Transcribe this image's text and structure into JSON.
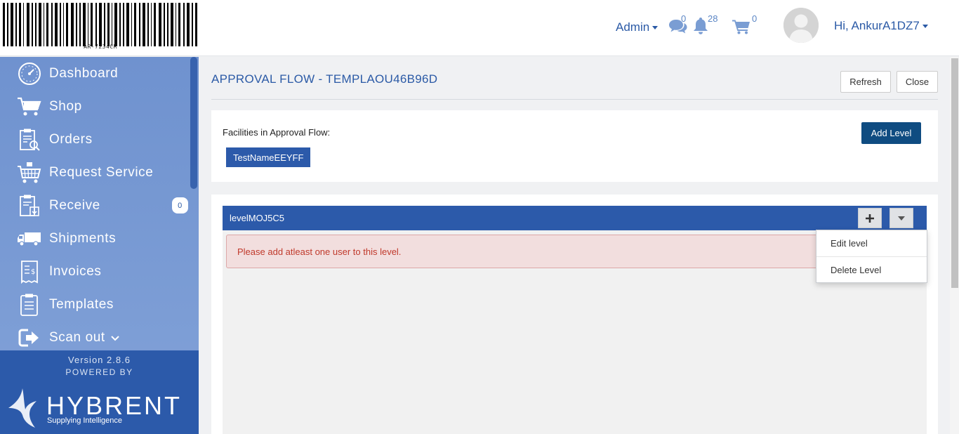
{
  "header": {
    "barcode_text": "AR-7234CR",
    "admin_label": "Admin",
    "messages_count": "0",
    "notifications_count": "28",
    "cart_count": "0",
    "user_greeting": "Hi, AnkurA1DZ7"
  },
  "sidebar": {
    "items": [
      {
        "label": "Dashboard",
        "icon": "dashboard-icon"
      },
      {
        "label": "Shop",
        "icon": "cart-icon"
      },
      {
        "label": "Orders",
        "icon": "orders-clipboard-icon"
      },
      {
        "label": "Request Service",
        "icon": "service-cart-icon"
      },
      {
        "label": "Receive",
        "icon": "receive-icon",
        "badge": "0"
      },
      {
        "label": "Shipments",
        "icon": "truck-icon"
      },
      {
        "label": "Invoices",
        "icon": "invoice-icon"
      },
      {
        "label": "Templates",
        "icon": "templates-icon"
      },
      {
        "label": "Scan out",
        "icon": "scan-out-icon"
      }
    ],
    "footer": {
      "version": "Version 2.8.6",
      "powered_by": "POWERED BY",
      "brand": "HYBRENT",
      "tagline": "Supplying Intelligence"
    }
  },
  "main": {
    "title": "APPROVAL FLOW - TEMPLAOU46B96D",
    "refresh_label": "Refresh",
    "close_label": "Close",
    "facilities_label": "Facilities in Approval Flow:",
    "facility_chip": "TestNameEEYFF",
    "add_level_label": "Add Level",
    "level": {
      "name": "levelMOJ5C5",
      "alert": "Please add atleast one user to this level.",
      "menu": [
        "Edit level",
        "Delete Level"
      ]
    }
  },
  "colors": {
    "primary": "#2c5aaa",
    "dark_primary": "#0f4c81",
    "sidebar": "#7698d2",
    "alert_bg": "#f2dede",
    "alert_text": "#c0392b"
  }
}
